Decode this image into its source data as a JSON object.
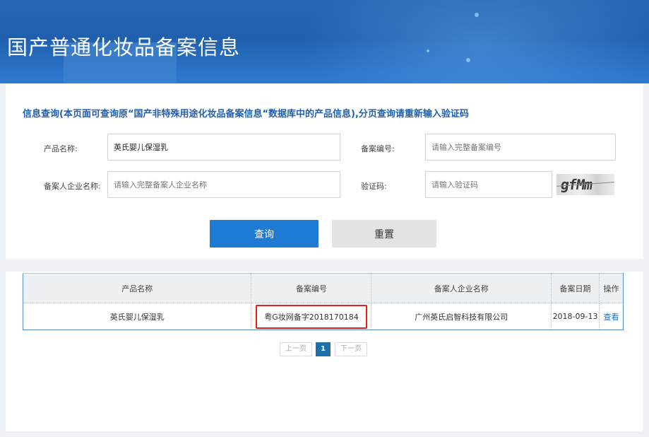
{
  "banner": {
    "title": "国产普通化妆品备案信息"
  },
  "notice": "信息查询(本页面可查询原“国产非特殊用途化妆品备案信息“数据库中的产品信息),分页查询请重新输入验证码",
  "form": {
    "product_name": {
      "label": "产品名称:",
      "value": "英氏婴儿保湿乳",
      "placeholder": ""
    },
    "reg_no": {
      "label": "备案编号:",
      "value": "",
      "placeholder": "请输入完整备案编号"
    },
    "company": {
      "label": "备案人企业名称:",
      "value": "",
      "placeholder": "请输入完整备案人企业名称"
    },
    "captcha": {
      "label": "验证码:",
      "value": "",
      "placeholder": "请输入验证码",
      "image_text": "gfMm"
    },
    "query_button": "查询",
    "reset_button": "重置"
  },
  "table": {
    "headers": [
      "产品名称",
      "备案编号",
      "备案人企业名称",
      "备案日期",
      "操作"
    ],
    "rows": [
      {
        "product": "英氏婴儿保湿乳",
        "reg_no": "粤G妆网备字2018170184",
        "company": "广州英氏启智科技有限公司",
        "date": "2018-09-13",
        "action": "查看"
      }
    ]
  },
  "pagination": {
    "prev": "上一页",
    "current": "1",
    "next": "下一页"
  },
  "colors": {
    "banner": "#1f5fad",
    "primary": "#1f7ad4",
    "highlight_box": "#e0221a",
    "link": "#1f6fc5"
  }
}
